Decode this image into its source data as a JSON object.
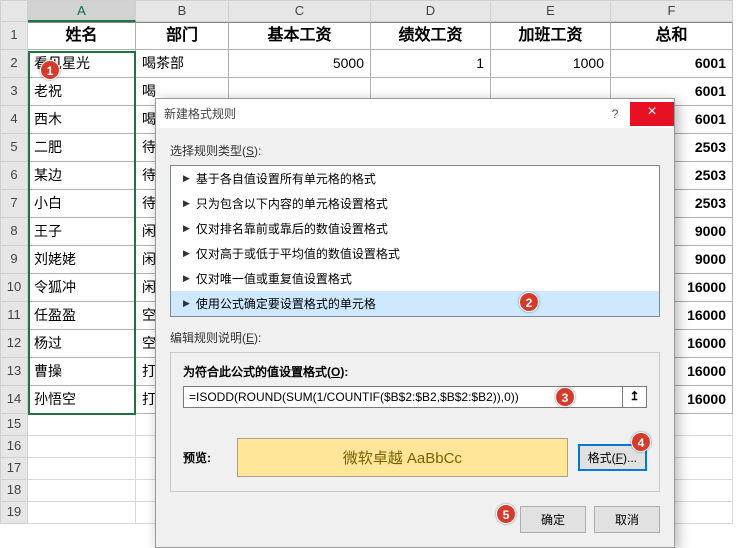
{
  "columns": [
    "A",
    "B",
    "C",
    "D",
    "E",
    "F"
  ],
  "header_row": [
    "姓名",
    "部门",
    "基本工资",
    "绩效工资",
    "加班工资",
    "总和"
  ],
  "rows": [
    {
      "n": "2",
      "c": [
        "看见星光",
        "喝茶部",
        "5000",
        "1",
        "1000",
        "6001"
      ]
    },
    {
      "n": "3",
      "c": [
        "老祝",
        "喝",
        "",
        "",
        "",
        "6001"
      ]
    },
    {
      "n": "4",
      "c": [
        "西木",
        "喝",
        "",
        "",
        "",
        "6001"
      ]
    },
    {
      "n": "5",
      "c": [
        "二肥",
        "待",
        "",
        "",
        "",
        "2503"
      ]
    },
    {
      "n": "6",
      "c": [
        "某边",
        "待",
        "",
        "",
        "",
        "2503"
      ]
    },
    {
      "n": "7",
      "c": [
        "小白",
        "待",
        "",
        "",
        "",
        "2503"
      ]
    },
    {
      "n": "8",
      "c": [
        "王子",
        "闲",
        "",
        "",
        "",
        "9000"
      ]
    },
    {
      "n": "9",
      "c": [
        "刘姥姥",
        "闲",
        "",
        "",
        "",
        "9000"
      ]
    },
    {
      "n": "10",
      "c": [
        "令狐冲",
        "闲",
        "",
        "",
        "",
        "16000"
      ]
    },
    {
      "n": "11",
      "c": [
        "任盈盈",
        "空",
        "",
        "",
        "",
        "16000"
      ]
    },
    {
      "n": "12",
      "c": [
        "杨过",
        "空",
        "",
        "",
        "",
        "16000"
      ]
    },
    {
      "n": "13",
      "c": [
        "曹操",
        "打",
        "",
        "",
        "",
        "16000"
      ]
    },
    {
      "n": "14",
      "c": [
        "孙悟空",
        "打",
        "",
        "",
        "",
        "16000"
      ]
    }
  ],
  "empty_rows": [
    "15",
    "16",
    "17",
    "18",
    "19"
  ],
  "dialog": {
    "title": "新建格式规则",
    "help": "?",
    "close": "×",
    "select_label_pre": "选择规则类型(",
    "select_label_u": "S",
    "select_label_post": "):",
    "rules": [
      "基于各自值设置所有单元格的格式",
      "只为包含以下内容的单元格设置格式",
      "仅对排名靠前或靠后的数值设置格式",
      "仅对高于或低于平均值的数值设置格式",
      "仅对唯一值或重复值设置格式",
      "使用公式确定要设置格式的单元格"
    ],
    "edit_label_pre": "编辑规则说明(",
    "edit_label_u": "E",
    "edit_label_post": "):",
    "formula_label_pre": "为符合此公式的值设置格式(",
    "formula_label_u": "O",
    "formula_label_post": "):",
    "formula_value": "=ISODD(ROUND(SUM(1/COUNTIF($B$2:$B2,$B$2:$B2)),0))",
    "picker": "↥",
    "preview_label": "预览:",
    "preview_text": "微软卓越 AaBbCc",
    "format_btn_pre": "格式(",
    "format_btn_u": "F",
    "format_btn_post": ")...",
    "ok": "确定",
    "cancel": "取消"
  },
  "badges": {
    "b1": "1",
    "b2": "2",
    "b3": "3",
    "b4": "4",
    "b5": "5"
  }
}
